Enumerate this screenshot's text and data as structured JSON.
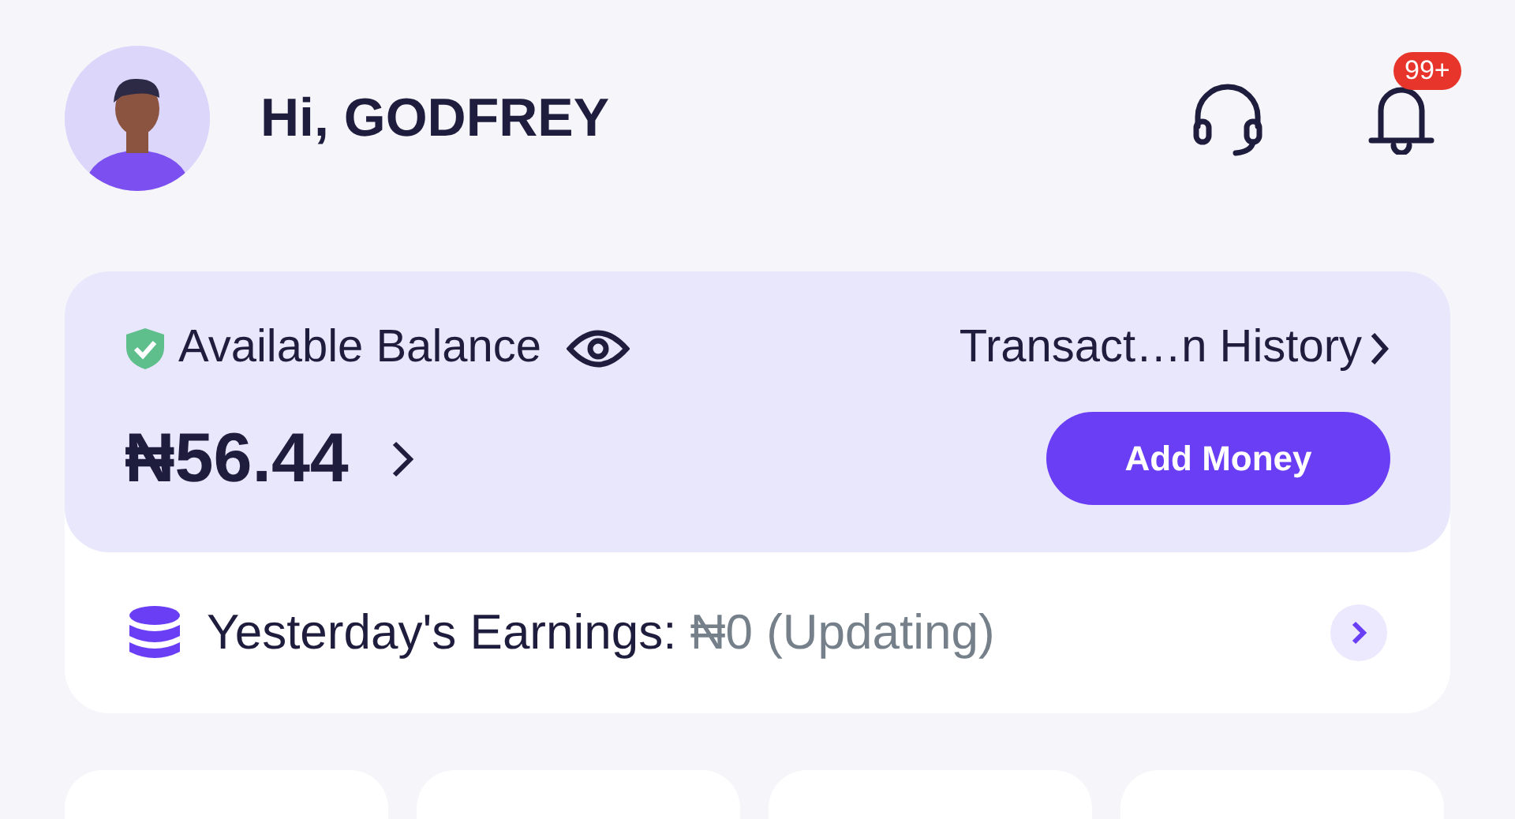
{
  "header": {
    "greeting": "Hi, GODFREY",
    "notification_badge": "99+"
  },
  "balance_card": {
    "label": "Available Balance",
    "transaction_link": "Transact…n History",
    "amount": "₦56.44",
    "add_money_button": "Add Money"
  },
  "earnings": {
    "label": "Yesterday's Earnings:",
    "value": "₦0 (Updating)"
  }
}
